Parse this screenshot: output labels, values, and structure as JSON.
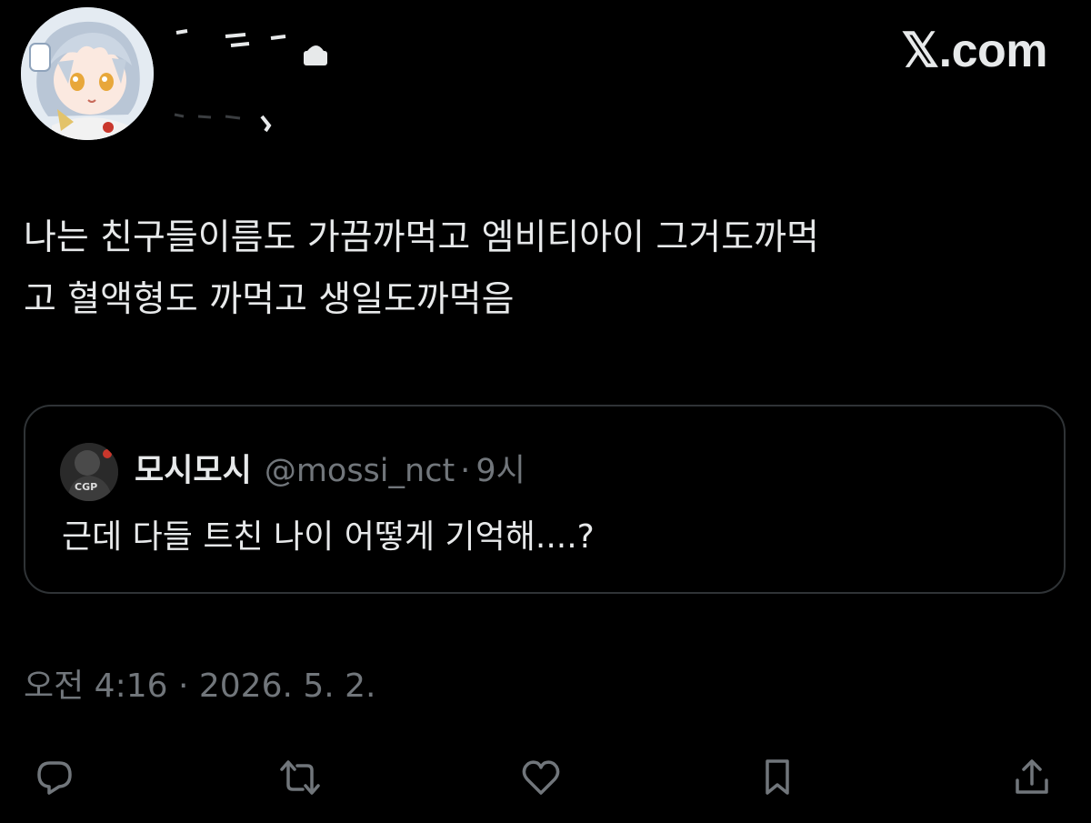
{
  "header": {
    "brand": "𝕏.com"
  },
  "tweet": {
    "text": "나는 친구들이름도 가끔까먹고 엠비티아이 그거도까먹\n고 혈액형도 까먹고 생일도까먹음",
    "timestamp": "오전 4:16 · 2026. 5. 2."
  },
  "quote": {
    "name": "모시모시",
    "handle": "@mossi_nct",
    "separator": "·",
    "time": "9시",
    "text": "근데 다들 트친 나이 어떻게 기억해....?",
    "avatar_caption": "CGP"
  },
  "actions": [
    {
      "icon": "reply-icon"
    },
    {
      "icon": "retweet-icon"
    },
    {
      "icon": "like-icon"
    },
    {
      "icon": "bookmark-icon"
    },
    {
      "icon": "share-icon"
    }
  ],
  "colors": {
    "background": "#000000",
    "text_primary": "#e7e9ea",
    "text_secondary": "#71767b",
    "border": "#2f3336"
  }
}
